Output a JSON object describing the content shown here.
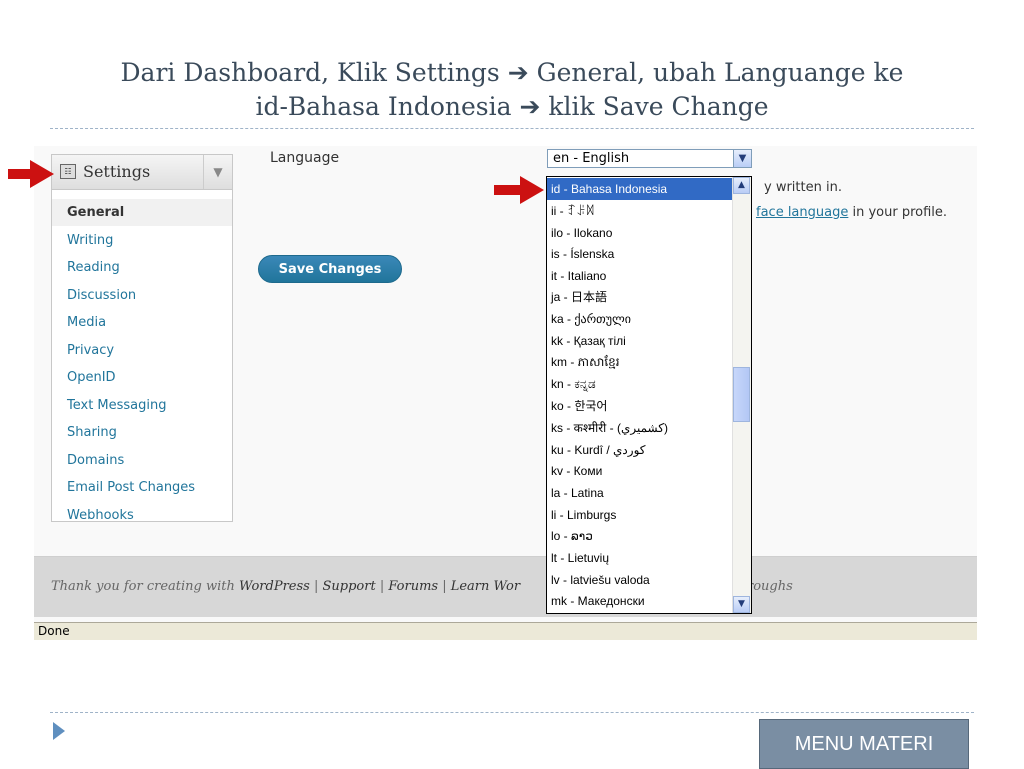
{
  "slide": {
    "title_line1": "Dari Dashboard, Klik Settings ➔ General, ubah Languange ke",
    "title_line2": "id-Bahasa Indonesia ➔ klik Save Change",
    "menu_button": "MENU MATERI"
  },
  "sidebar": {
    "header_label": "Settings",
    "items": [
      {
        "label": "General",
        "current": true
      },
      {
        "label": "Writing"
      },
      {
        "label": "Reading"
      },
      {
        "label": "Discussion"
      },
      {
        "label": "Media"
      },
      {
        "label": "Privacy"
      },
      {
        "label": "OpenID"
      },
      {
        "label": "Text Messaging"
      },
      {
        "label": "Sharing"
      },
      {
        "label": "Domains"
      },
      {
        "label": "Email Post Changes"
      },
      {
        "label": "Webhooks"
      }
    ]
  },
  "settings": {
    "language_label": "Language",
    "language_value": "en - English",
    "desc_line1": "y written in.",
    "desc_link": "face language",
    "desc_line2_rest": " in your profile.",
    "save_button": "Save Changes"
  },
  "dropdown": {
    "options": [
      "id - Bahasa Indonesia",
      "ii - ꆈꌠꉙ",
      "ilo - Ilokano",
      "is - Íslenska",
      "it - Italiano",
      "ja - 日本語",
      "ka - ქართული",
      "kk - Қазақ тілі",
      "km - ភាសាខ្មែរ",
      "kn - ಕನ್ನಡ",
      "ko - 한국어",
      "ks - कश्मीरी - (كشميري)",
      "ku - Kurdî / كوردي",
      "kv - Коми",
      "la - Latina",
      "li - Limburgs",
      "lo - ລາວ",
      "lt - Lietuvių",
      "lv - latviešu valoda",
      "mk - Македонски"
    ],
    "selected_index": 0
  },
  "footer": {
    "thank_you": "Thank you for creating with ",
    "wordpress": "WordPress",
    "sep1": " | ",
    "support": "Support",
    "sep2": " | ",
    "forums": "Forums",
    "sep3": " | ",
    "learn": "Learn Wor",
    "walkthroughs": "roughs"
  },
  "statusbar": {
    "text": "Done"
  },
  "colors": {
    "link": "#21759b",
    "selection": "#316ac5",
    "arrow": "#cc1111",
    "menu_button_bg": "#7a8ea3"
  }
}
